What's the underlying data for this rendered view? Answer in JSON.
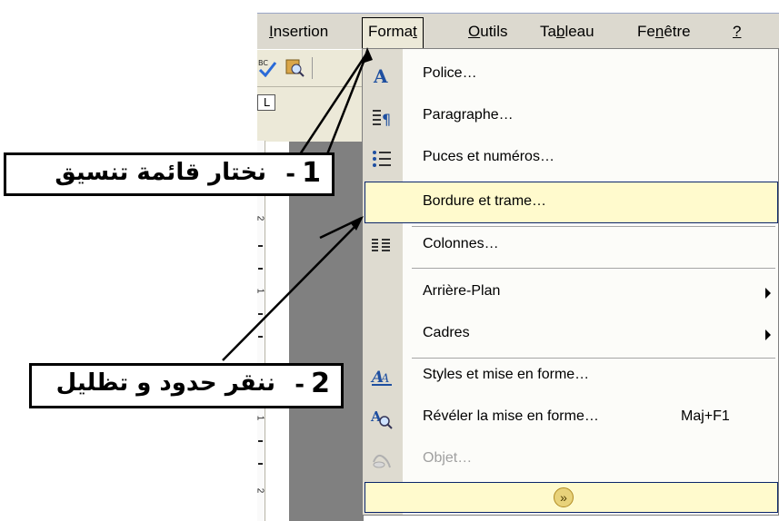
{
  "menubar": {
    "items": [
      {
        "label": "Insertion",
        "accel": "I"
      },
      {
        "label": "Format",
        "accel": "t"
      },
      {
        "label": "Outils",
        "accel": "O"
      },
      {
        "label": "Tableau",
        "accel": "b"
      },
      {
        "label": "Fenêtre",
        "accel": "n"
      },
      {
        "label": "?"
      }
    ]
  },
  "menu": {
    "items": [
      {
        "label": "Police…",
        "icon": "font-a-icon"
      },
      {
        "label": "Paragraphe…",
        "icon": "paragraph-icon"
      },
      {
        "label": "Puces et numéros…",
        "icon": "bullets-icon"
      },
      {
        "label": "Bordure et trame…",
        "icon": "",
        "highlighted": true
      },
      {
        "label": "Colonnes…",
        "icon": "columns-icon"
      },
      {
        "label": "Arrière-Plan",
        "submenu": true
      },
      {
        "label": "Cadres",
        "submenu": true
      },
      {
        "label": "Styles et mise en forme…",
        "icon": "styles-icon"
      },
      {
        "label": "Révéler la mise en forme…",
        "shortcut": "Maj+F1",
        "icon": "reveal-formatting-icon"
      },
      {
        "label": "Objet…",
        "icon": "object-icon",
        "disabled": true
      }
    ],
    "expand_icon": "chevrons-down-icon"
  },
  "ruler": {
    "marker": "L",
    "numbers": [
      "2",
      "1",
      "1",
      "2"
    ]
  },
  "callouts": [
    {
      "number": "1",
      "dash": "-",
      "text": "نختار قائمة تنسيق"
    },
    {
      "number": "2",
      "dash": "-",
      "text": "ننقر حدود و تظليل"
    }
  ],
  "colors": {
    "highlight": "#fffacd",
    "highlight_border": "#0a246a",
    "menubar": "#dcd9cf",
    "gutter": "#dedbd0"
  }
}
